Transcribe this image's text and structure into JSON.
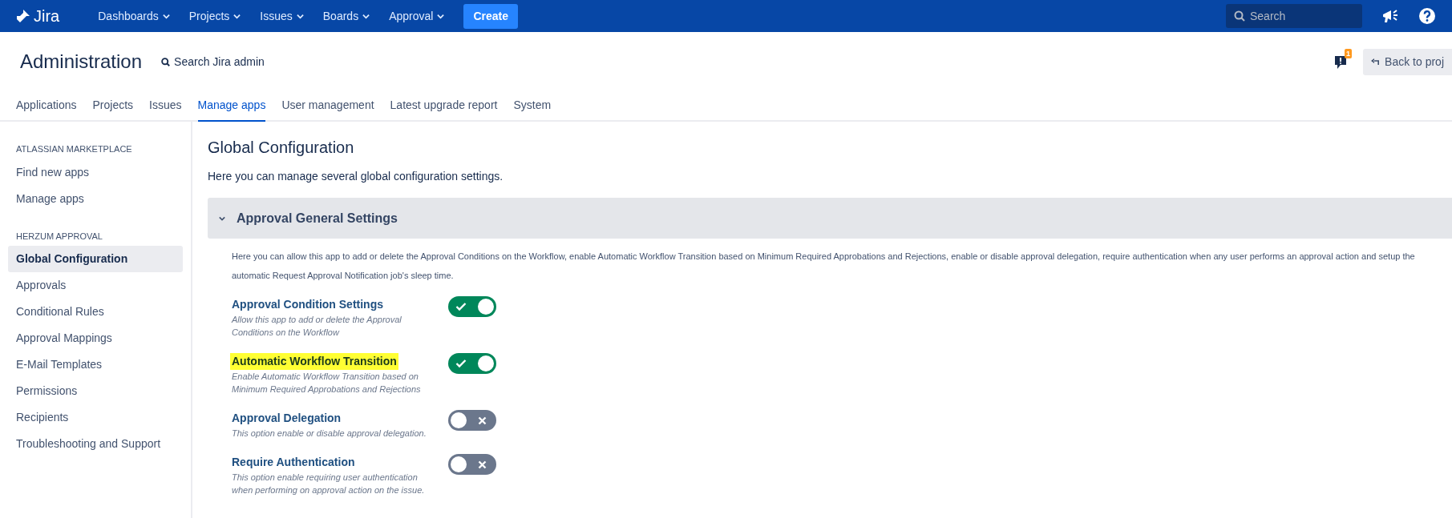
{
  "topnav": {
    "logo": "Jira",
    "menus": [
      {
        "label": "Dashboards"
      },
      {
        "label": "Projects"
      },
      {
        "label": "Issues"
      },
      {
        "label": "Boards"
      },
      {
        "label": "Approval"
      }
    ],
    "create": "Create",
    "search": {
      "placeholder": "Search"
    }
  },
  "header": {
    "title": "Administration",
    "search_link": "Search Jira admin",
    "notification_count": "1",
    "back_button": "Back to proj"
  },
  "tabs": [
    {
      "label": "Applications",
      "selected": false
    },
    {
      "label": "Projects",
      "selected": false
    },
    {
      "label": "Issues",
      "selected": false
    },
    {
      "label": "Manage apps",
      "selected": true
    },
    {
      "label": "User management",
      "selected": false
    },
    {
      "label": "Latest upgrade report",
      "selected": false
    },
    {
      "label": "System",
      "selected": false
    }
  ],
  "sidebar": {
    "sections": [
      {
        "heading": "ATLASSIAN MARKETPLACE",
        "items": [
          {
            "label": "Find new apps",
            "selected": false
          },
          {
            "label": "Manage apps",
            "selected": false
          }
        ]
      },
      {
        "heading": "HERZUM APPROVAL",
        "items": [
          {
            "label": "Global Configuration",
            "selected": true
          },
          {
            "label": "Approvals",
            "selected": false
          },
          {
            "label": "Conditional Rules",
            "selected": false
          },
          {
            "label": "Approval Mappings",
            "selected": false
          },
          {
            "label": "E-Mail Templates",
            "selected": false
          },
          {
            "label": "Permissions",
            "selected": false
          },
          {
            "label": "Recipients",
            "selected": false
          },
          {
            "label": "Troubleshooting and Support",
            "selected": false
          }
        ]
      }
    ]
  },
  "content": {
    "title": "Global Configuration",
    "intro": "Here you can manage several global configuration settings.",
    "panel": {
      "title": "Approval General Settings",
      "expanded": true,
      "description": "Here you can allow this app to add or delete the Approval Conditions on the Workflow, enable Automatic Workflow Transition based on Minimum Required Approbations and Rejections, enable or disable approval delegation, require authentication when any user performs an approval action and setup the automatic Request Approval Notification job's sleep time.",
      "settings": [
        {
          "title": "Approval Condition Settings",
          "description": "Allow this app to add or delete the Approval Conditions on the Workflow",
          "on": true,
          "highlighted": false
        },
        {
          "title": "Automatic Workflow Transition",
          "description": "Enable Automatic Workflow Transition based on Minimum Required Approbations and Rejections",
          "on": true,
          "highlighted": true
        },
        {
          "title": "Approval Delegation",
          "description": "This option enable or disable approval delegation.",
          "on": false,
          "highlighted": false
        },
        {
          "title": "Require Authentication",
          "description": "This option enable requiring user authentication when performing on approval action on the issue.",
          "on": false,
          "highlighted": false
        }
      ]
    }
  }
}
